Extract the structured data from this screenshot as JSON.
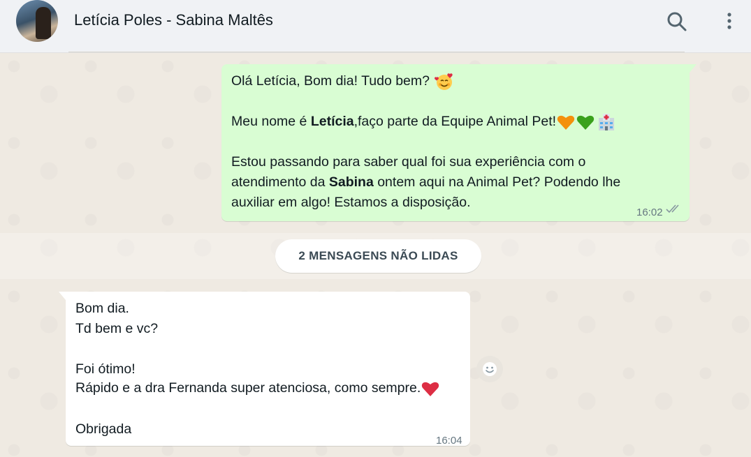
{
  "header": {
    "contact_name": "Letícia Poles - Sabina Maltês",
    "search_icon": "search-icon",
    "menu_icon": "kebab-menu-icon"
  },
  "outgoing": {
    "line1": "Olá Letícia, Bom dia! Tudo bem?",
    "line2_pre": "Meu nome é ",
    "line2_bold": "Letícia",
    "line2_post": ",faço parte da Equipe Animal Pet!",
    "line3": "Estou passando para saber qual foi sua experiência com o",
    "line4_pre": "atendimento da ",
    "line4_bold": "Sabina",
    "line4_post": " ontem aqui na Animal Pet? Podendo lhe",
    "line5": "auxiliar em algo! Estamos a disposição.",
    "time": "16:02",
    "status": "read"
  },
  "unread_label": "2 MENSAGENS NÃO LIDAS",
  "incoming": {
    "line1": "Bom dia.",
    "line2": "Td bem e vc?",
    "line3": "Foi ótimo!",
    "line4": "Rápido e a dra Fernanda super atenciosa, como sempre.",
    "line5": "Obrigada",
    "time": "16:04"
  },
  "colors": {
    "outgoing_bubble": "#d9fdd3",
    "incoming_bubble": "#ffffff",
    "chat_background": "#efeae2",
    "header_background": "#f0f2f5"
  }
}
